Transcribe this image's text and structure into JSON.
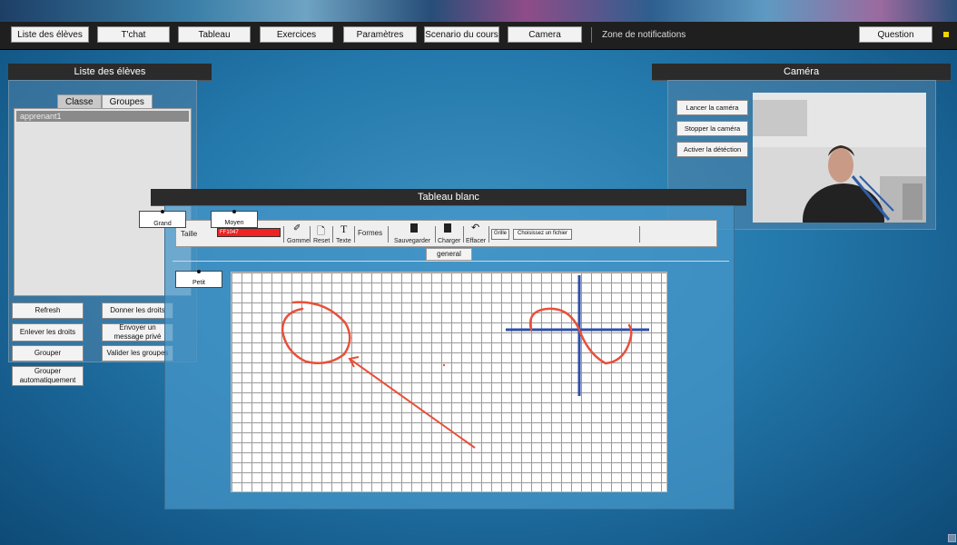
{
  "menu": {
    "items": [
      "Liste des élèves",
      "T'chat",
      "Tableau",
      "Exercices",
      "Paramètres",
      "Scenario du cours",
      "Camera"
    ],
    "notifications": "Zone de notifications",
    "question": "Question"
  },
  "students_panel": {
    "title": "Liste des élèves",
    "tabs": [
      "Classe",
      "Groupes"
    ],
    "students": [
      "apprenant1"
    ],
    "buttons": {
      "refresh": "Refresh",
      "give_rights": "Donner les droits",
      "remove_rights": "Enlever les droits",
      "private_message": "Envoyer un message privé",
      "group": "Grouper",
      "validate_groups": "Valider les groupes",
      "auto_group": "Grouper automatiquement"
    }
  },
  "camera_panel": {
    "title": "Caméra",
    "buttons": {
      "start": "Lancer la caméra",
      "stop": "Stopper la caméra",
      "detect": "Activer la détéction"
    }
  },
  "whiteboard": {
    "title": "Tableau blanc",
    "size_label": "Taille",
    "color_value": "FF1047",
    "tools": {
      "eraser": "Gomme",
      "reset": "Reset",
      "text": "Texte",
      "shapes": "Formes",
      "save": "Sauvegarder",
      "load": "Charger",
      "clear": "Effacer",
      "grid": "Grille",
      "choose_file": "Choisissez un fichier"
    },
    "tab": "general",
    "size_options": {
      "large": "Grand",
      "medium": "Moyen",
      "small": "Petit"
    }
  },
  "colors": {
    "stroke_red": "#e8503a",
    "stroke_blue": "#2c4fa8",
    "menubar": "#1f1f1f"
  }
}
